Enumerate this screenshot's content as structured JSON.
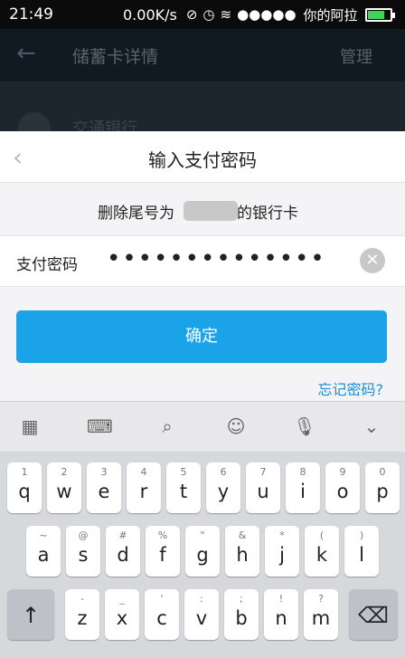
{
  "status_bar": {
    "time": "21:49",
    "speed": "0.00K/s",
    "carrier": "你的阿拉",
    "signal": "●●●●●"
  },
  "app_header": {
    "title": "储蓄卡详情",
    "manage": "管理",
    "bank_name": "交通银行"
  },
  "dialog": {
    "title": "输入支付密码",
    "subtitle_prefix": "删除尾号为",
    "subtitle_suffix": "的银行卡",
    "password_label": "支付密码",
    "password_value": "••••••••••••••",
    "confirm_label": "确定",
    "forgot_label": "忘记密码?"
  },
  "keyboard": {
    "row1": [
      {
        "main": "q",
        "sub": "1"
      },
      {
        "main": "w",
        "sub": "2"
      },
      {
        "main": "e",
        "sub": "3"
      },
      {
        "main": "r",
        "sub": "4"
      },
      {
        "main": "t",
        "sub": "5"
      },
      {
        "main": "y",
        "sub": "6"
      },
      {
        "main": "u",
        "sub": "7"
      },
      {
        "main": "i",
        "sub": "8"
      },
      {
        "main": "o",
        "sub": "9"
      },
      {
        "main": "p",
        "sub": "0"
      }
    ],
    "row2": [
      {
        "main": "a",
        "sub": "~"
      },
      {
        "main": "s",
        "sub": "@"
      },
      {
        "main": "d",
        "sub": "#"
      },
      {
        "main": "f",
        "sub": "%"
      },
      {
        "main": "g",
        "sub": "\""
      },
      {
        "main": "h",
        "sub": "&"
      },
      {
        "main": "j",
        "sub": "*"
      },
      {
        "main": "k",
        "sub": "("
      },
      {
        "main": "l",
        "sub": ")"
      }
    ],
    "row3": [
      {
        "main": "z",
        "sub": "-"
      },
      {
        "main": "x",
        "sub": "_"
      },
      {
        "main": "c",
        "sub": "'"
      },
      {
        "main": "v",
        "sub": ":"
      },
      {
        "main": "b",
        "sub": ";"
      },
      {
        "main": "n",
        "sub": "!"
      },
      {
        "main": "m",
        "sub": "?"
      }
    ]
  },
  "colors": {
    "accent": "#1aa3e8",
    "link": "#1a8fd6"
  }
}
